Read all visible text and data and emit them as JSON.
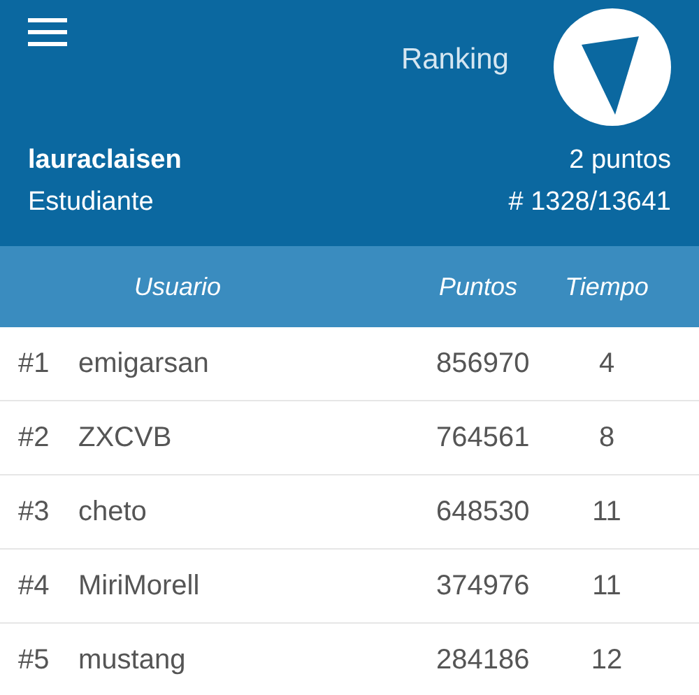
{
  "header": {
    "title": "Ranking",
    "username": "lauraclaisen",
    "role": "Estudiante",
    "points": "2 puntos",
    "position": "# 1328/13641"
  },
  "table": {
    "columns": [
      "Usuario",
      "Puntos",
      "Tiempo"
    ],
    "rows": [
      {
        "rank": "#1",
        "user": "emigarsan",
        "points": "856970",
        "time": "4"
      },
      {
        "rank": "#2",
        "user": "ZXCVB",
        "points": "764561",
        "time": "8"
      },
      {
        "rank": "#3",
        "user": "cheto",
        "points": "648530",
        "time": "11"
      },
      {
        "rank": "#4",
        "user": "MiriMorell",
        "points": "374976",
        "time": "11"
      },
      {
        "rank": "#5",
        "user": "mustang",
        "points": "284186",
        "time": "12"
      }
    ]
  }
}
